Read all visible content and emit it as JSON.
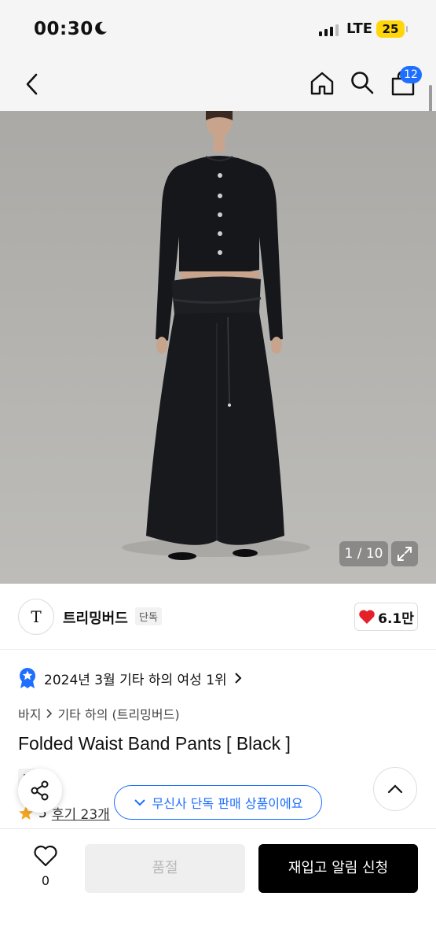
{
  "status_bar": {
    "time": "00:30",
    "network": "LTE",
    "battery": "25"
  },
  "nav": {
    "cart_count": "12"
  },
  "gallery": {
    "counter": "1 / 10"
  },
  "brand": {
    "logo_text": "T",
    "name": "트리밍버드",
    "tag": "단독",
    "likes": "6.1만"
  },
  "rank": {
    "text": "2024년 3월 기타 하의 여성 1위"
  },
  "breadcrumb": {
    "level1": "바지",
    "level2": "기타 하의 (트리밍버드)"
  },
  "product": {
    "title": "Folded Waist Band Pants [ Black ]",
    "tag": "단독",
    "rating": "5",
    "reviews": "후기 23개"
  },
  "exclusive_notice": "무신사 단독 판매 상품이에요",
  "bottom_bar": {
    "wish_count": "0",
    "soldout_label": "품절",
    "restock_label": "재입고 알림 신청"
  },
  "colors": {
    "accent": "#1e6fff",
    "heart": "#e5202b",
    "star": "#f5a623",
    "battery": "#ffd60a"
  }
}
